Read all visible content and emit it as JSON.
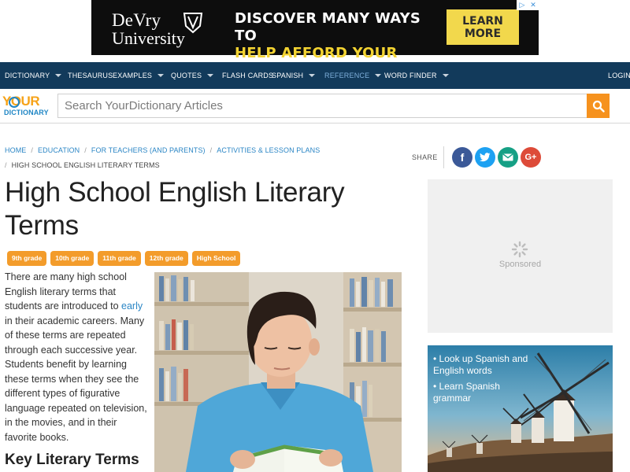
{
  "ad": {
    "brand_line1": "DeVry",
    "brand_line2": "University",
    "headline_line1": "DISCOVER MANY WAYS TO",
    "headline_line2": "HELP AFFORD YOUR DEGREE",
    "cta_line1": "LEARN",
    "cta_line2": "MORE",
    "choices_icon": "ad-choices-icon",
    "close_icon": "close-icon"
  },
  "nav": {
    "items": [
      {
        "label": "DICTIONARY",
        "dropdown": true
      },
      {
        "label": "THESAURUS",
        "dropdown": false
      },
      {
        "label": "EXAMPLES",
        "dropdown": true
      },
      {
        "label": "QUOTES",
        "dropdown": true
      },
      {
        "label": "FLASH CARDS",
        "dropdown": false
      },
      {
        "label": "SPANISH",
        "dropdown": true
      },
      {
        "label": "REFERENCE",
        "dropdown": true,
        "active": true
      },
      {
        "label": "WORD FINDER",
        "dropdown": true
      }
    ],
    "login": "LOGIN",
    "bg_color": "#123a5b",
    "active_color": "#7fb0dc"
  },
  "logo": {
    "line1": "YOUR",
    "line2": "DICTIONARY"
  },
  "search": {
    "placeholder": "Search YourDictionary Articles",
    "value": "",
    "icon": "search-icon",
    "button_color": "#f6921e"
  },
  "breadcrumbs": [
    "HOME",
    "EDUCATION",
    "FOR TEACHERS (AND PARENTS)",
    "ACTIVITIES & LESSON PLANS",
    "HIGH SCHOOL ENGLISH LITERARY TERMS"
  ],
  "share": {
    "label": "SHARE",
    "buttons": [
      {
        "name": "facebook-icon",
        "glyph": "f",
        "color": "#3b5998"
      },
      {
        "name": "twitter-icon",
        "glyph": "t",
        "color": "#1da1f2"
      },
      {
        "name": "email-icon",
        "glyph": "✉",
        "color": "#16a085"
      },
      {
        "name": "google-plus-icon",
        "glyph": "G+",
        "color": "#dd4b39"
      }
    ]
  },
  "article": {
    "title": "High School English Literary Terms",
    "tags": [
      "9th grade",
      "10th grade",
      "11th grade",
      "12th grade",
      "High School"
    ],
    "tag_color": "#f39c2b",
    "para_before_link": "There are many high school English literary terms that students are introduced to ",
    "para_link": "early",
    "para_after_link": " in their academic careers. Many of these terms are repeated through each successive year. Students benefit by learning these terms when they see the different types of figurative language repeated on television, in the movies, and in their favorite books.",
    "section_heading": "Key Literary Terms"
  },
  "sponsored": {
    "label": "Sponsored"
  },
  "spanish_box": {
    "items": [
      "Look up Spanish and English words",
      "Learn Spanish grammar"
    ]
  }
}
